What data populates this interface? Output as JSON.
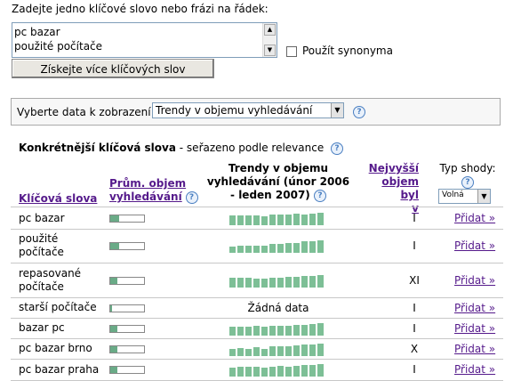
{
  "input_prompt": "Zadejte jedno klíčové slovo nebo frázi na řádek:",
  "keywords_input_lines": [
    "pc bazar",
    "použité počítače"
  ],
  "synonyms_label": "Použít synonyma",
  "more_keywords_button": "Získejte více klíčových slov",
  "data_select_label": "Vyberte data k zobrazení:",
  "data_select_value": "Trendy v objemu vyhledávání",
  "section_title_bold": "Konkrétnější klíčová slova",
  "section_title_rest": " - seřazeno podle relevance",
  "columns": {
    "keyword": "Klíčová slova",
    "avg_volume": [
      "Prům. objem",
      "vyhledávání"
    ],
    "trends": [
      "Trendy v objemu",
      "vyhledávání (únor 2006",
      "- leden 2007)"
    ],
    "highest_volume": [
      "Nejvyšší",
      "objem byl",
      "v"
    ],
    "match_type": "Typ shody:",
    "match_value": "Volná"
  },
  "no_data_text": "Žádná data",
  "add_label": "Přidat »",
  "rows": [
    {
      "keyword": [
        "pc bazar"
      ],
      "avg_fill": 0.25,
      "trend": [
        0.75,
        0.75,
        0.8,
        0.75,
        0.7,
        0.85,
        0.85,
        0.85,
        0.9,
        0.85,
        0.95,
        1.0
      ],
      "peak": "I"
    },
    {
      "keyword": [
        "použité",
        "počítače"
      ],
      "avg_fill": 0.25,
      "trend": [
        0.5,
        0.6,
        0.6,
        0.55,
        0.6,
        0.7,
        0.7,
        0.75,
        0.8,
        0.9,
        0.9,
        1.0
      ],
      "peak": "I"
    },
    {
      "keyword": [
        "repasované",
        "počítače"
      ],
      "avg_fill": 0.22,
      "trend": [
        0.8,
        0.8,
        0.75,
        0.7,
        0.7,
        0.75,
        0.8,
        0.85,
        0.85,
        0.9,
        0.95,
        1.0
      ],
      "peak": "XI"
    },
    {
      "keyword": [
        "starší počítače"
      ],
      "avg_fill": 0.05,
      "trend": null,
      "peak": "I"
    },
    {
      "keyword": [
        "bazar pc"
      ],
      "avg_fill": 0.22,
      "trend": [
        0.7,
        0.7,
        0.7,
        0.75,
        0.7,
        0.8,
        0.8,
        0.8,
        0.85,
        0.85,
        0.9,
        1.0
      ],
      "peak": "I"
    },
    {
      "keyword": [
        "pc bazar brno"
      ],
      "avg_fill": 0.2,
      "trend": [
        0.6,
        0.65,
        0.6,
        0.7,
        0.6,
        0.75,
        0.8,
        0.75,
        0.85,
        0.9,
        0.95,
        1.0
      ],
      "peak": "X"
    },
    {
      "keyword": [
        "pc bazar praha"
      ],
      "avg_fill": 0.22,
      "trend": [
        0.7,
        0.75,
        0.8,
        0.75,
        0.7,
        0.8,
        0.85,
        0.8,
        0.85,
        0.9,
        0.9,
        1.0
      ],
      "peak": "I"
    }
  ]
}
